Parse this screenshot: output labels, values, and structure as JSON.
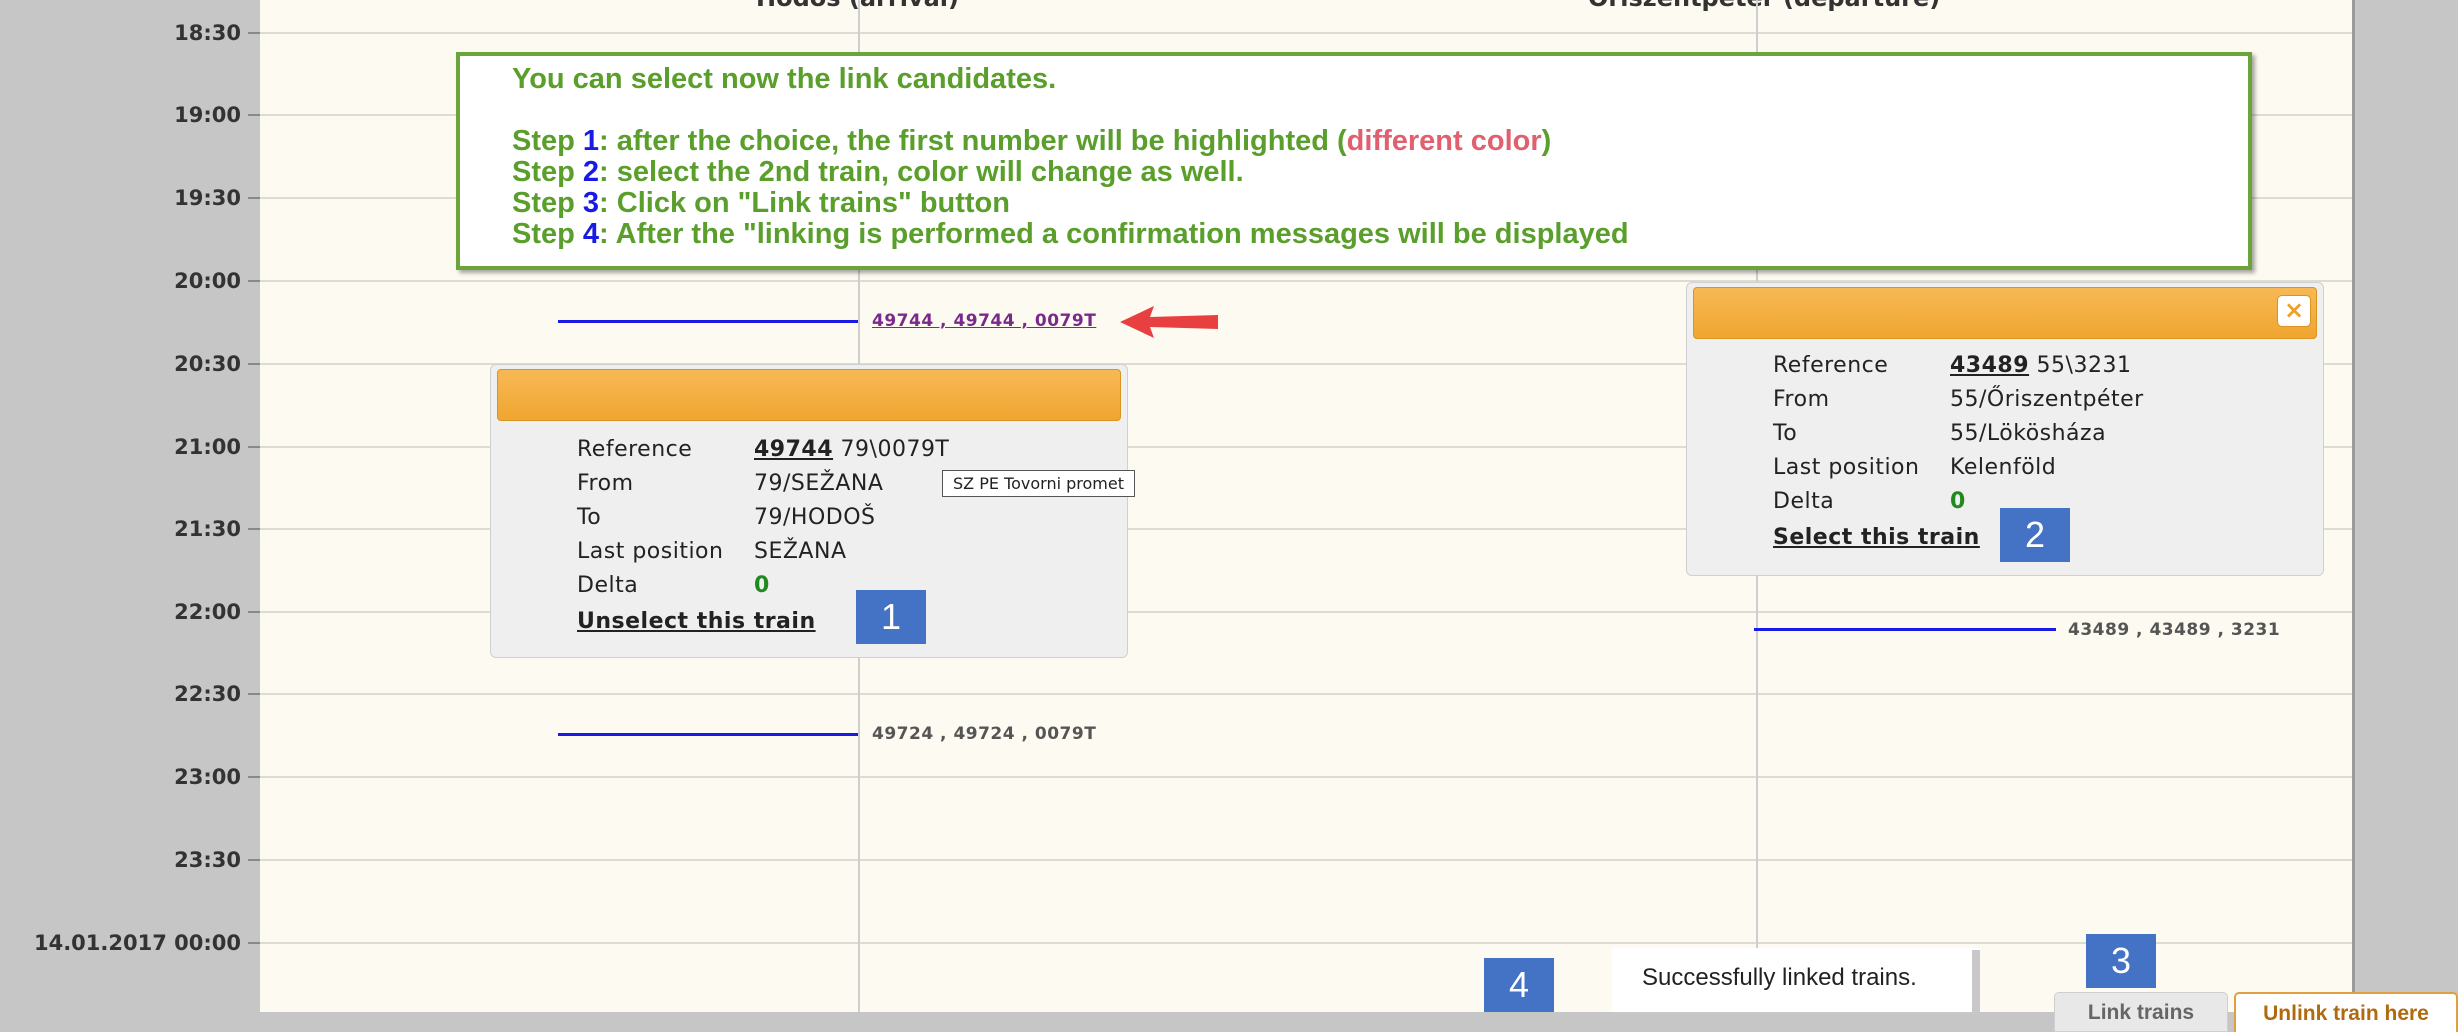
{
  "timeline": {
    "column_headers": [
      "Hodoš (arrival)",
      "Őriszentpéter (departure)"
    ],
    "time_labels": [
      "18:30",
      "19:00",
      "19:30",
      "20:00",
      "20:30",
      "21:00",
      "21:30",
      "22:00",
      "22:30",
      "23:00",
      "23:30",
      "14.01.2017 00:00"
    ]
  },
  "instructions": {
    "line1": "You can select now the link candidates.",
    "step1_prefix": "Step ",
    "step1_num": "1",
    "step1_text": ": after the choice, the first number will be highlighted (",
    "step1_red": "different color",
    "step1_end": ")",
    "step2_prefix": "Step ",
    "step2_num": "2",
    "step2_text": ": select the 2nd train, color will change as well.",
    "step3_prefix": "Step ",
    "step3_num": "3",
    "step3_text": ": Click on \"Link trains\" button",
    "step4_prefix": "Step ",
    "step4_num": "4",
    "step4_text": ": After the \"linking is performed a confirmation messages will be displayed"
  },
  "trains": {
    "t1_label": "49744 , 49744 , 0079T",
    "t2_label": "49724 , 49724 , 0079T",
    "t3_label": "43489 , 43489 , 3231"
  },
  "popup_left": {
    "reference_label": "Reference",
    "reference_num": "49744",
    "reference_rest": " 79\\0079T",
    "from_label": "From",
    "from_value": "79/SEŽANA",
    "to_label": "To",
    "to_value": "79/HODOŠ",
    "lastpos_label": "Last position",
    "lastpos_value": "SEŽANA",
    "delta_label": "Delta",
    "delta_value": "0",
    "action": "Unselect this train"
  },
  "popup_right": {
    "reference_label": "Reference",
    "reference_num": "43489",
    "reference_rest": " 55\\3231",
    "from_label": "From",
    "from_value": "55/Őriszentpéter",
    "to_label": "To",
    "to_value": "55/Lökösháza",
    "lastpos_label": "Last position",
    "lastpos_value": "Kelenföld",
    "delta_label": "Delta",
    "delta_value": "0",
    "action": "Select this train",
    "close": "×"
  },
  "tooltip": "SZ PE Tovorni promet",
  "badges": [
    "1",
    "2",
    "3",
    "4"
  ],
  "message": "Successfully linked trains.",
  "buttons": {
    "link": "Link trains",
    "unlink": "Unlink train here"
  },
  "colors": {
    "accent_orange": "#f0a530",
    "train_line": "#1a1ae6",
    "instruction_green": "#5a9e2c",
    "badge_blue": "#4472c4"
  }
}
